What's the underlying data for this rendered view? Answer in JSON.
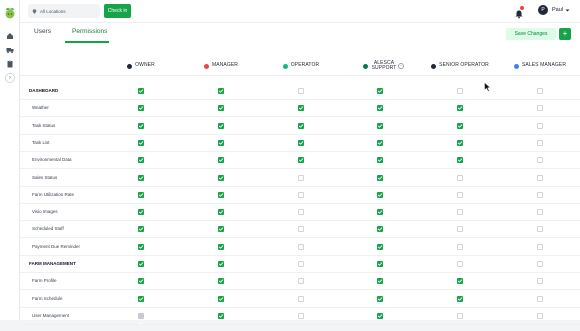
{
  "topbar": {
    "location_placeholder": "All Locations",
    "checkin_label": "Check in",
    "user_initial": "P",
    "user_name": "Paul"
  },
  "tabs": [
    {
      "label": "Users",
      "active": false
    },
    {
      "label": "Permissions",
      "active": true
    }
  ],
  "actions": {
    "save_label": "Save Changes",
    "add_label": "+"
  },
  "roles": [
    {
      "name": "OWNER",
      "color": "#1f2937"
    },
    {
      "name": "MANAGER",
      "color": "#ef4444"
    },
    {
      "name": "OPERATOR",
      "color": "#10b981"
    },
    {
      "name": "ALESCA SUPPORT",
      "color": "#047857"
    },
    {
      "name": "SENIOR OPERATOR",
      "color": "#1f2937"
    },
    {
      "name": "SALES MANAGER",
      "color": "#3b82f6"
    }
  ],
  "rows": [
    {
      "label": "DASHBOARD",
      "section": true,
      "perms": [
        1,
        1,
        0,
        1,
        0,
        0
      ]
    },
    {
      "label": "Weather",
      "section": false,
      "perms": [
        1,
        1,
        1,
        1,
        1,
        0
      ]
    },
    {
      "label": "Task Status",
      "section": false,
      "perms": [
        1,
        1,
        1,
        1,
        1,
        0
      ]
    },
    {
      "label": "Task List",
      "section": false,
      "perms": [
        1,
        1,
        1,
        1,
        1,
        0
      ]
    },
    {
      "label": "Environmental Data",
      "section": false,
      "perms": [
        1,
        1,
        1,
        1,
        1,
        0
      ]
    },
    {
      "label": "Sales Status",
      "section": false,
      "perms": [
        1,
        1,
        0,
        1,
        0,
        0
      ]
    },
    {
      "label": "Farm Utilization Rate",
      "section": false,
      "perms": [
        1,
        1,
        0,
        1,
        0,
        0
      ]
    },
    {
      "label": "Visio Images",
      "section": false,
      "perms": [
        1,
        1,
        0,
        1,
        0,
        0
      ]
    },
    {
      "label": "Scheduled Staff",
      "section": false,
      "perms": [
        1,
        1,
        0,
        1,
        0,
        0
      ]
    },
    {
      "label": "Payment Due Reminder",
      "section": false,
      "perms": [
        1,
        1,
        0,
        1,
        0,
        0
      ]
    },
    {
      "label": "FARM MANAGEMENT",
      "section": true,
      "perms": [
        1,
        1,
        0,
        1,
        0,
        0
      ]
    },
    {
      "label": "Farm Profile",
      "section": false,
      "perms": [
        1,
        1,
        0,
        1,
        1,
        0
      ]
    },
    {
      "label": "Farm Schedule",
      "section": false,
      "perms": [
        1,
        1,
        0,
        1,
        1,
        0
      ]
    },
    {
      "label": "User Management",
      "section": false,
      "perms": [
        2,
        1,
        0,
        1,
        0,
        0
      ]
    }
  ],
  "colors": {
    "accent": "#16a34a",
    "accent_light": "#dcfce7"
  }
}
